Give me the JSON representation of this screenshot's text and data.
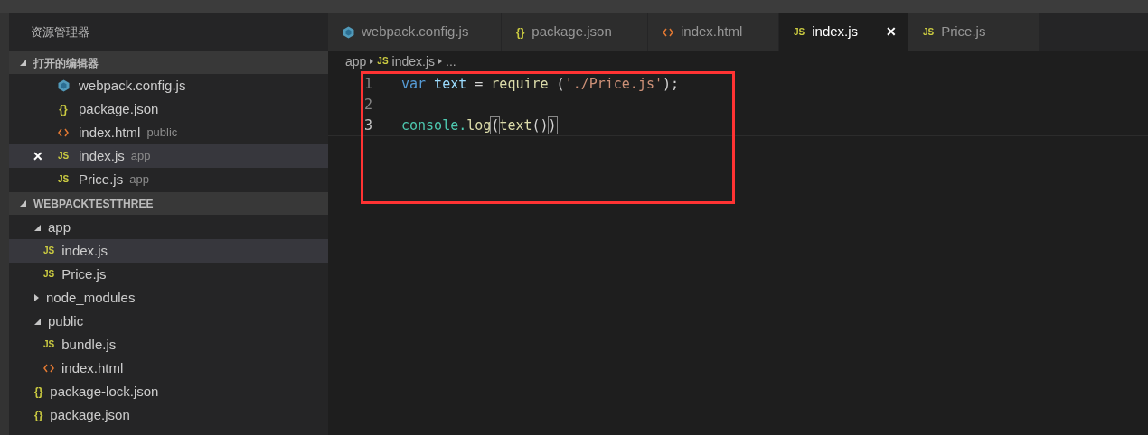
{
  "sidebar": {
    "title": "资源管理器",
    "open_editors": {
      "title": "打开的编辑器",
      "expanded": true,
      "items": [
        {
          "name": "webpack.config.js",
          "kind": "webpack",
          "selected": false
        },
        {
          "name": "package.json",
          "kind": "json",
          "icon": "{}",
          "selected": false
        },
        {
          "name": "index.html",
          "kind": "html",
          "folder": "public",
          "selected": false
        },
        {
          "name": "index.js",
          "kind": "js",
          "icon": "JS",
          "folder": "app",
          "selected": true,
          "close": "✕"
        },
        {
          "name": "Price.js",
          "kind": "js",
          "icon": "JS",
          "folder": "app",
          "selected": false
        }
      ]
    },
    "project": {
      "title": "WEBPACKTESTTHREE",
      "expanded": true,
      "tree": [
        {
          "name": "app",
          "kind": "folder",
          "expanded": true,
          "selected": false,
          "children": [
            {
              "name": "index.js",
              "kind": "js",
              "icon": "JS",
              "selected": true
            },
            {
              "name": "Price.js",
              "kind": "js",
              "icon": "JS",
              "selected": false
            }
          ]
        },
        {
          "name": "node_modules",
          "kind": "folder",
          "expanded": false,
          "selected": false
        },
        {
          "name": "public",
          "kind": "folder",
          "expanded": true,
          "selected": false,
          "children": [
            {
              "name": "bundle.js",
              "kind": "js",
              "icon": "JS",
              "selected": false
            },
            {
              "name": "index.html",
              "kind": "html",
              "selected": false
            }
          ]
        },
        {
          "name": "package-lock.json",
          "kind": "json",
          "icon": "{}",
          "selected": false
        },
        {
          "name": "package.json",
          "kind": "json",
          "icon": "{}",
          "selected": false
        }
      ]
    }
  },
  "tabs": [
    {
      "label": "webpack.config.js",
      "kind": "webpack",
      "selected": false
    },
    {
      "label": "package.json",
      "kind": "json",
      "icon": "{}",
      "selected": false
    },
    {
      "label": "index.html",
      "kind": "html",
      "selected": false
    },
    {
      "label": "index.js",
      "kind": "js",
      "icon": "JS",
      "selected": true,
      "close": "✕"
    },
    {
      "label": "Price.js",
      "kind": "js",
      "icon": "JS",
      "selected": false
    }
  ],
  "breadcrumb": [
    {
      "label": "app",
      "kind": "folder"
    },
    {
      "label": "index.js",
      "kind": "js",
      "icon": "JS"
    },
    {
      "label": "...",
      "kind": "more"
    }
  ],
  "code": [
    {
      "number": "1",
      "current": false,
      "tokens": [
        {
          "t": "var",
          "color": "#569cd6"
        },
        {
          "t": " text",
          "color": "#9cdcfe"
        },
        {
          "t": " = ",
          "color": "#d4d4d4"
        },
        {
          "t": "require",
          "color": "#dcdcaa"
        },
        {
          "t": " (",
          "color": "#d4d4d4"
        },
        {
          "t": "'./Price.js'",
          "color": "#ce9178"
        },
        {
          "t": ");",
          "color": "#d4d4d4"
        }
      ]
    },
    {
      "number": "2",
      "current": false
    },
    {
      "number": "3",
      "current": true,
      "tokens": [
        {
          "t": "console.",
          "color": "#4ec9b0"
        },
        {
          "t": "log",
          "color": "#dcdcaa"
        },
        {
          "t": "(",
          "color": "#d4d4d4",
          "matched": true
        },
        {
          "t": "text",
          "color": "#dcdcaa"
        },
        {
          "t": "()",
          "color": "#d4d4d4"
        },
        {
          "t": ")",
          "color": "#d4d4d4",
          "matched": true
        }
      ]
    }
  ]
}
